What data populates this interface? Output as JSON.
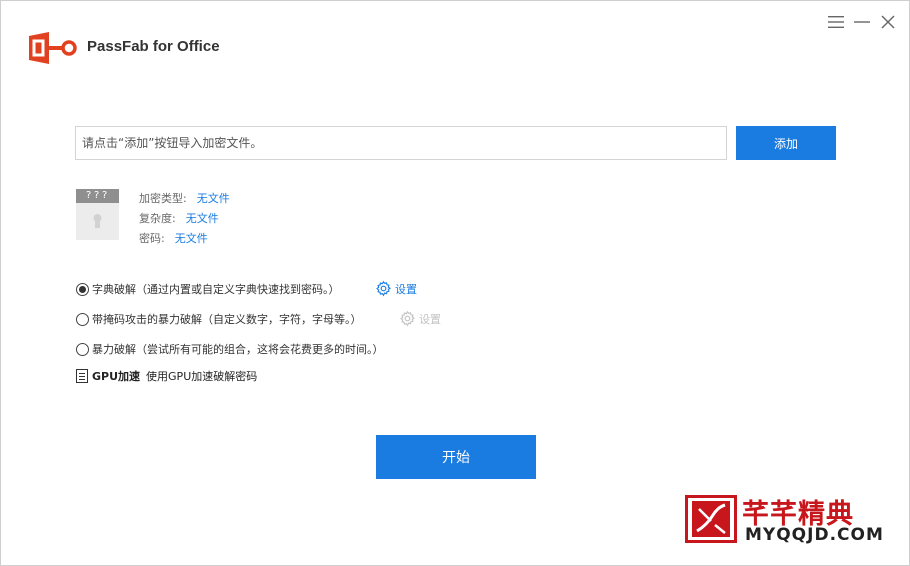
{
  "app": {
    "title": "PassFab for Office",
    "brand_color": "#e2411f"
  },
  "window_controls": {
    "menu_icon": "hamburger-menu-icon",
    "minimize_icon": "minimize-icon",
    "close_icon": "close-icon"
  },
  "file_import": {
    "placeholder": "请点击“添加”按钮导入加密文件。",
    "add_label": "添加"
  },
  "file_info": {
    "thumb_text": "???",
    "rows": [
      {
        "label": "加密类型:",
        "value": "无文件"
      },
      {
        "label": "复杂度:",
        "value": "无文件"
      },
      {
        "label": "密码:",
        "value": "无文件"
      }
    ]
  },
  "attack_options": [
    {
      "label": "字典破解（通过内置或自定义字典快速找到密码。）",
      "selected": true,
      "settings_label": "设置",
      "settings_enabled": true
    },
    {
      "label": "带掩码攻击的暴力破解（自定义数字，字符，字母等。）",
      "selected": false,
      "settings_label": "设置",
      "settings_enabled": false
    },
    {
      "label": "暴力破解（尝试所有可能的组合，这将会花费更多的时间。）",
      "selected": false
    }
  ],
  "gpu": {
    "label": "GPU加速",
    "description": "使用GPU加速破解密码"
  },
  "start_label": "开始",
  "watermark": {
    "title": "芊芊精典",
    "subtitle": "MYQQJD.COM",
    "color": "#c8161d"
  },
  "colors": {
    "accent": "#1a7be0",
    "disabled": "#c2c2c2"
  }
}
